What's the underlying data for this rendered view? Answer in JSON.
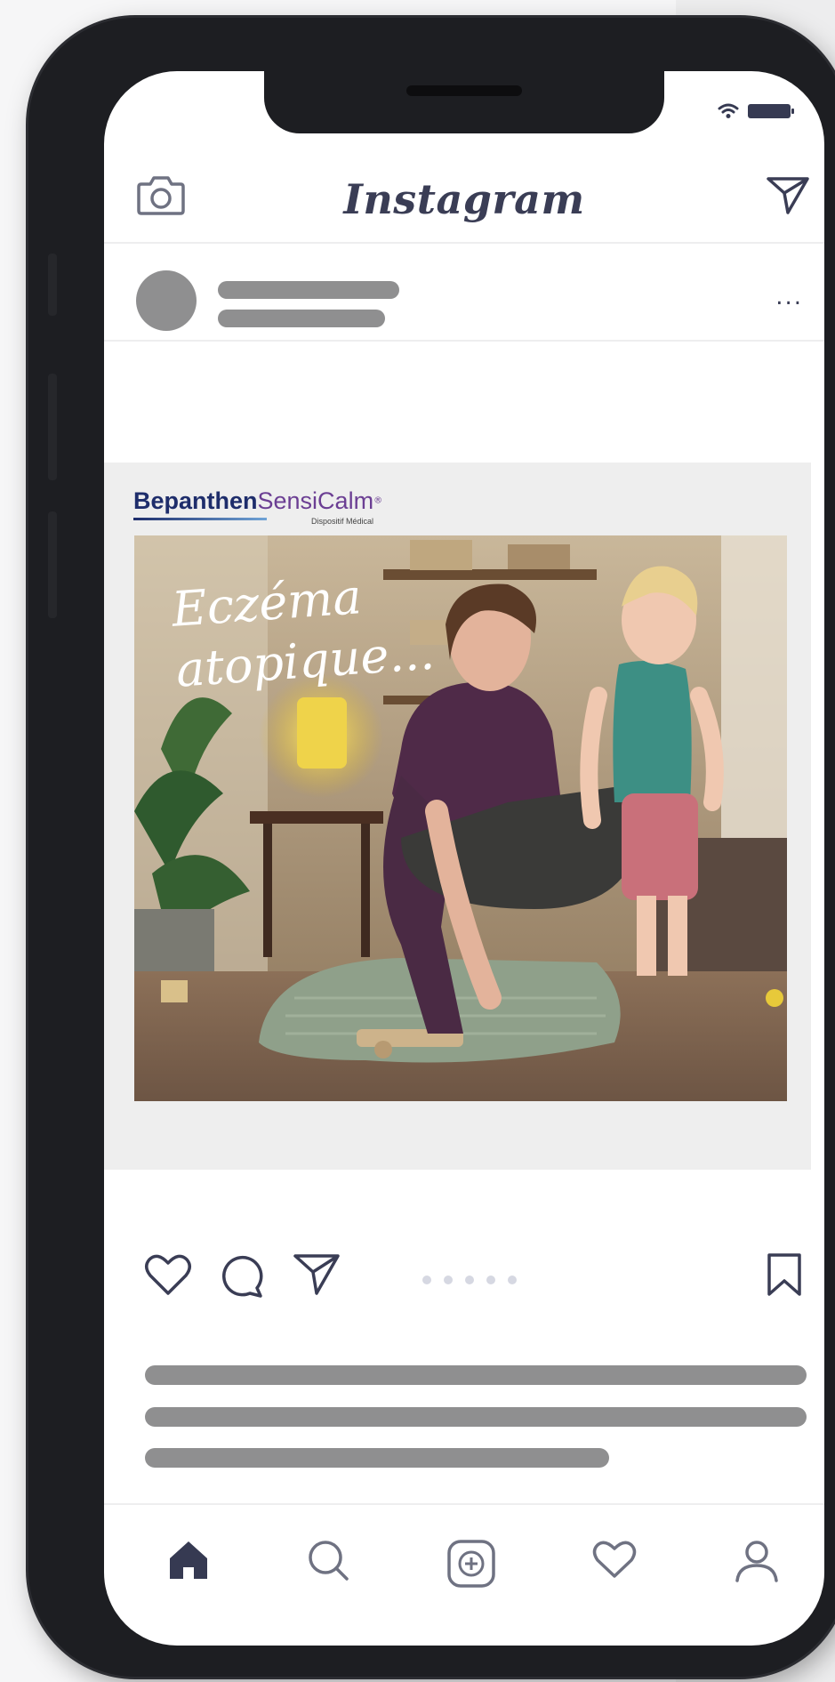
{
  "app": {
    "name": "Instagram"
  },
  "post": {
    "options_label": "..."
  },
  "ad": {
    "brand_primary": "Bepanthen",
    "brand_secondary": "SensiCalm",
    "brand_mark": "®",
    "brand_tagline": "Dispositif Médical",
    "headline_line1": "Eczéma",
    "headline_line2": "atopique..."
  },
  "icons": {
    "header_left": "camera-icon",
    "header_right": "direct-message-icon",
    "actions": [
      "heart-icon",
      "comment-icon",
      "share-icon",
      "bookmark-icon"
    ],
    "nav": [
      "home-icon",
      "search-icon",
      "add-post-icon",
      "activity-heart-icon",
      "profile-icon"
    ]
  },
  "carousel": {
    "count": 5
  },
  "colors": {
    "icon": "#3a3d55",
    "skeleton": "#8f8f90",
    "brand_blue": "#1e2d6b",
    "brand_purple": "#6b3e93"
  }
}
